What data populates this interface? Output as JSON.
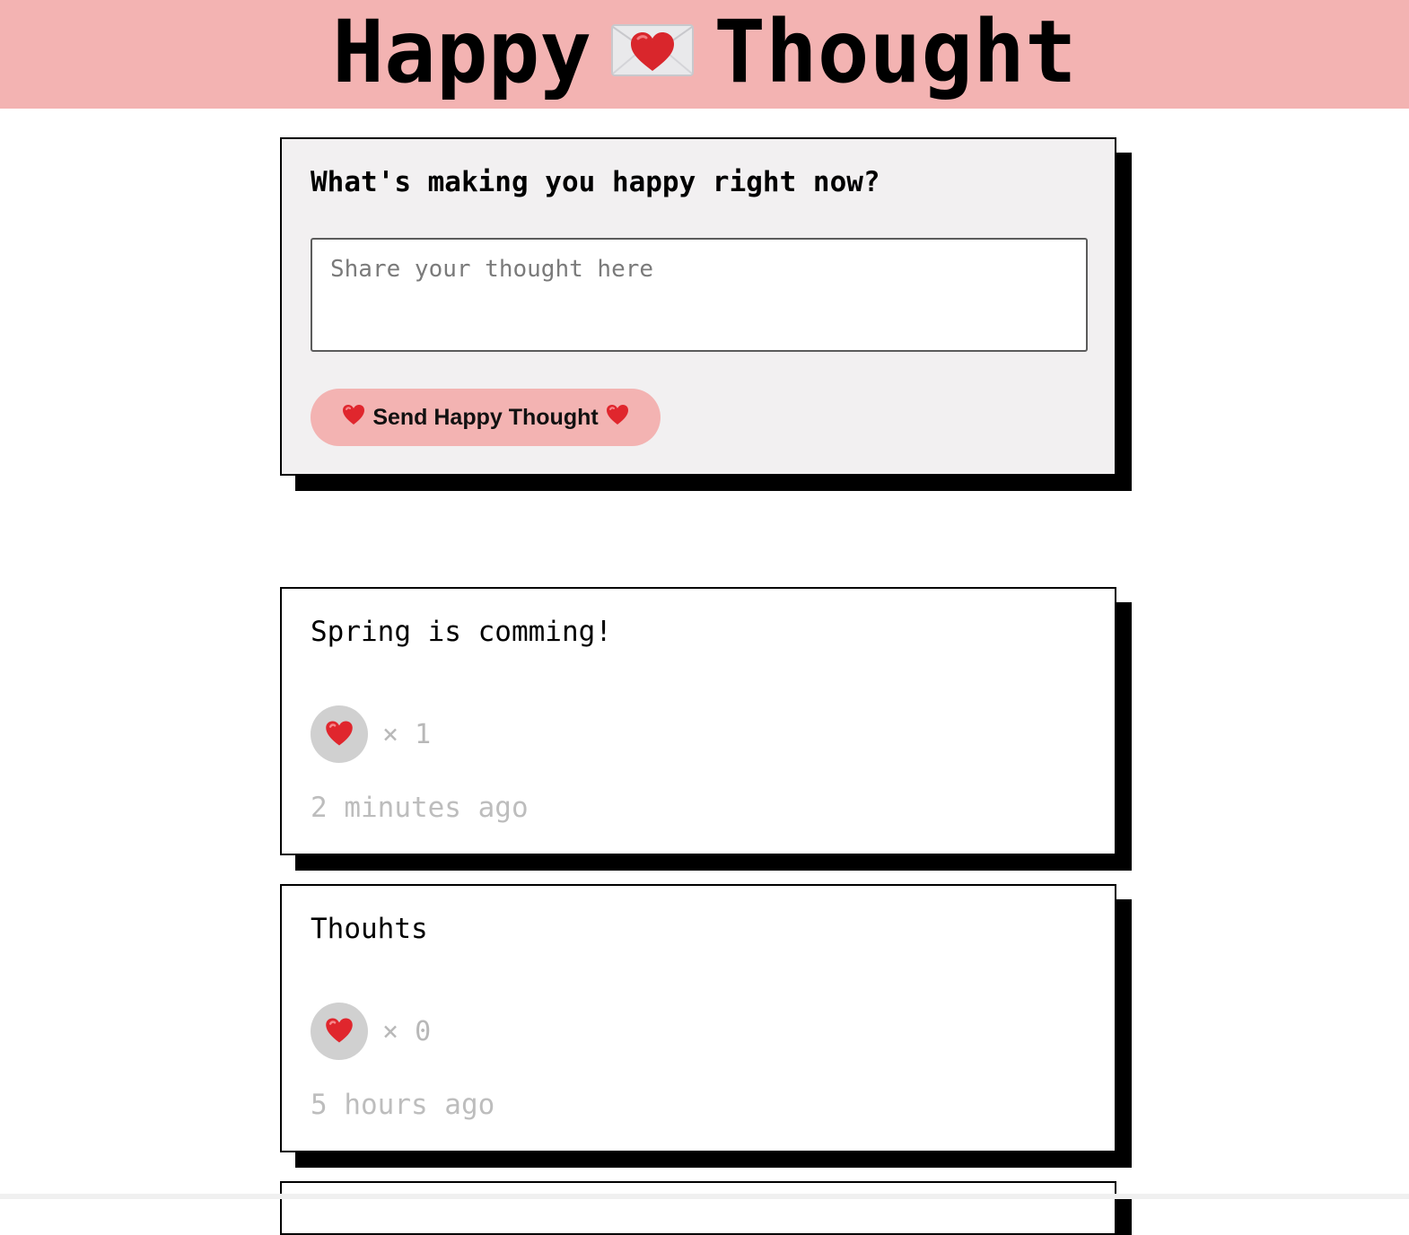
{
  "header": {
    "title_left": "Happy",
    "title_right": "Thought",
    "icon": "love-letter-icon",
    "background_color": "#f3b3b2"
  },
  "form": {
    "question": "What's making you happy right now?",
    "input_placeholder": "Share your thought here",
    "input_value": "",
    "send_button_label": "Send Happy Thought",
    "button_icon": "heart-icon"
  },
  "thoughts": [
    {
      "message": "Spring is comming!",
      "likes_label": "× 1",
      "time_ago": "2 minutes ago"
    },
    {
      "message": "Thouhts",
      "likes_label": "× 0",
      "time_ago": "5 hours ago"
    }
  ],
  "colors": {
    "accent_pink": "#f3b3b2",
    "form_background": "#f2f0f1",
    "like_button_gray": "#d0d0d0",
    "muted_text": "#bdbdbd"
  }
}
